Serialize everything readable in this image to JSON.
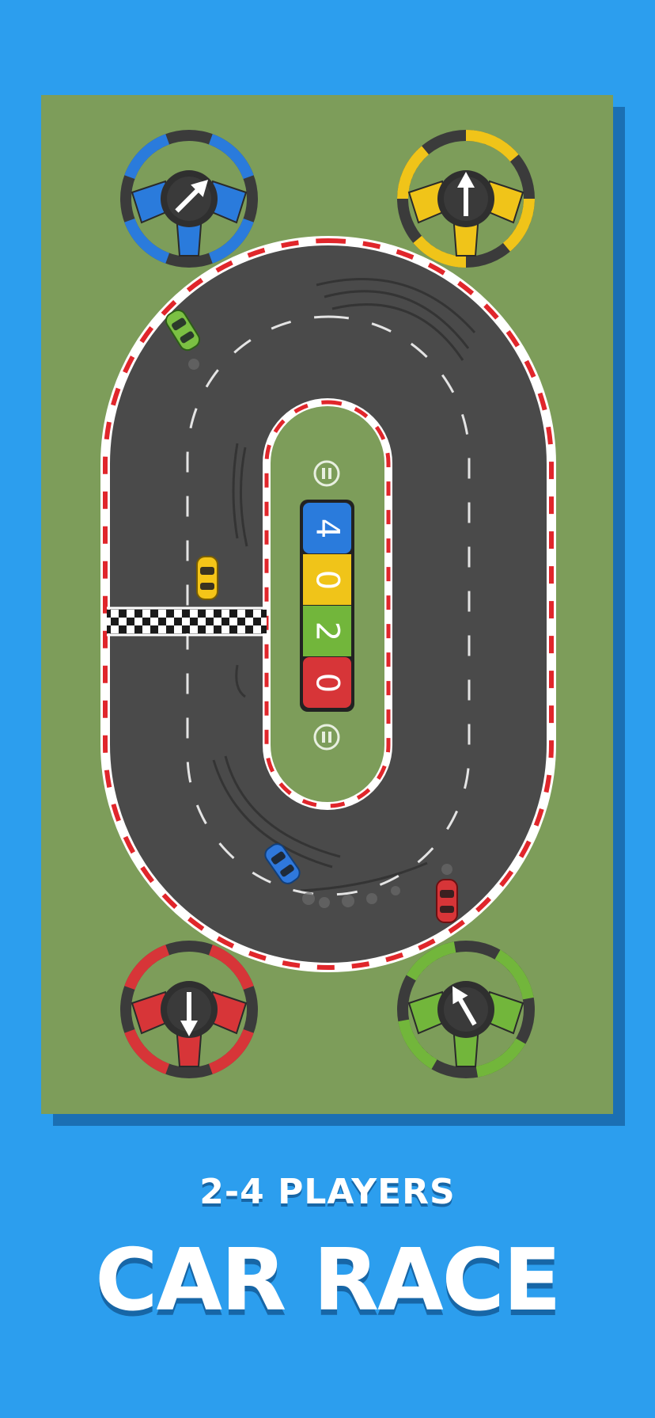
{
  "game": {
    "subtitle": "2-4 PLAYERS",
    "title": "CAR RACE"
  },
  "scoreboard": [
    {
      "player": "blue",
      "score": "4",
      "color": "#2a7bdc"
    },
    {
      "player": "yellow",
      "score": "0",
      "color": "#f0c419"
    },
    {
      "player": "green",
      "score": "2",
      "color": "#72b63b"
    },
    {
      "player": "red",
      "score": "0",
      "color": "#d73538"
    }
  ],
  "colors": {
    "background": "#2c9eee",
    "grass": "#7d9d5a",
    "asphalt": "#4a4a4a",
    "curb_red": "#e0262b",
    "curb_white": "#ffffff"
  },
  "controls": [
    {
      "player": "blue",
      "icon": "steering-wheel-icon",
      "color": "#2a7bdc"
    },
    {
      "player": "yellow",
      "icon": "steering-wheel-icon",
      "color": "#f0c419"
    },
    {
      "player": "red",
      "icon": "steering-wheel-icon",
      "color": "#d73538"
    },
    {
      "player": "green",
      "icon": "steering-wheel-icon",
      "color": "#72b63b"
    }
  ],
  "icons": [
    "pause-icon",
    "pause-icon",
    "finish-line-icon",
    "car-icon"
  ]
}
